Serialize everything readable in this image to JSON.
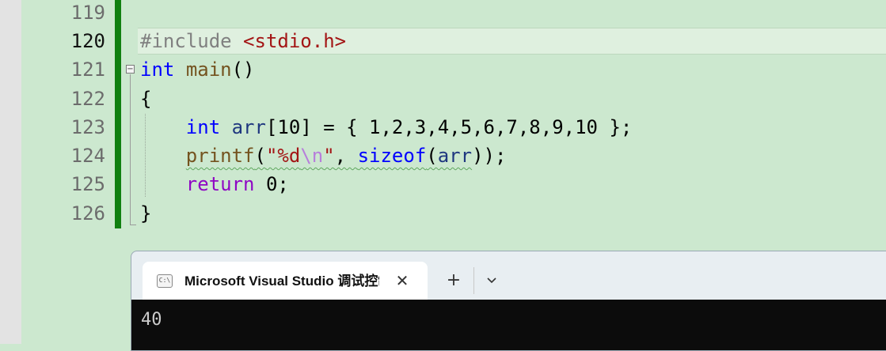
{
  "editor": {
    "line_numbers": [
      "119",
      "120",
      "121",
      "122",
      "123",
      "124",
      "125",
      "126"
    ],
    "current_line": "120",
    "code": {
      "l120": {
        "directive": "#include",
        "header": "<stdio.h>"
      },
      "l121": {
        "type_kw": "int",
        "func": "main",
        "parens": "()"
      },
      "l122": {
        "text": "{"
      },
      "l123": {
        "type_kw": "int",
        "var": "arr",
        "rest": "[10] = { 1,2,3,4,5,6,7,8,9,10 };"
      },
      "l124": {
        "func": "printf",
        "open": "(",
        "str_a": "\"%d",
        "str_esc": "\\n",
        "str_b": "\"",
        "comma": ", ",
        "kw": "sizeof",
        "p_open": "(",
        "var": "arr",
        "close": "));"
      },
      "l125": {
        "kw": "return",
        "rest": " 0;"
      },
      "l126": {
        "text": "}"
      }
    }
  },
  "terminal": {
    "tab_title": "Microsoft Visual Studio 调试控制台",
    "tab_icon": "console-icon",
    "close_glyph": "✕",
    "add_glyph": "+",
    "dropdown_icon": "chevron-down-icon",
    "output": "40"
  },
  "colors": {
    "editor_bg": "#cce8cf",
    "change_bar": "#108010",
    "keyword": "#0000ff",
    "string": "#a31515",
    "function": "#74531f",
    "control_keyword": "#8f08c4",
    "terminal_bg": "#0c0c0c"
  }
}
